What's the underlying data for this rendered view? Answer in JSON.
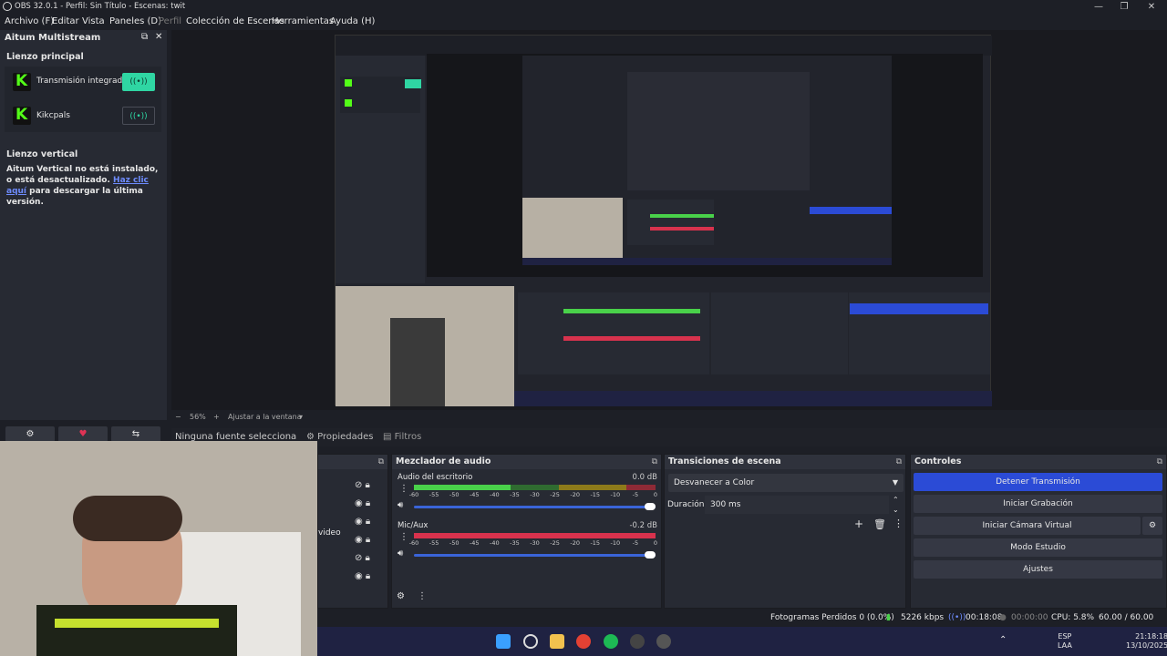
{
  "window": {
    "title": "OBS 32.0.1 - Perfil: Sin Título - Escenas: twit",
    "min": "—",
    "max": "❐",
    "close": "✕"
  },
  "menu": [
    "Archivo (F)",
    "Editar",
    "Vista",
    "Paneles (D)",
    "Perfil",
    "Colección de Escenas",
    "Herramientas",
    "Ayuda (H)"
  ],
  "aitum": {
    "title": "Aitum Multistream",
    "float_icon": "⧉",
    "close_icon": "✕",
    "main_canvas": "Lienzo principal",
    "outputs": [
      {
        "name": "Transmisión integrada",
        "status_icon": "((•))"
      },
      {
        "name": "Kikcpals",
        "status_icon": "((•))"
      }
    ],
    "vertical_canvas": "Lienzo vertical",
    "vertical_msg": "Aitum Vertical no está instalado, o está desactualizado.",
    "link": "Haz clic aquí",
    "link_rest": "para descargar la última versión."
  },
  "left_buttons": {
    "settings": "⚙",
    "heart": "♥",
    "share": "⇆"
  },
  "zoom": {
    "minus": "−",
    "value": "56%",
    "plus": "+",
    "fit": "Ajustar a la ventana",
    "arrow": "▾"
  },
  "sources_bar": {
    "none": "Ninguna fuente selecciona",
    "props": "Propiedades",
    "filters": "Filtros"
  },
  "sources_partial": {
    "video": "video"
  },
  "mixer": {
    "title": "Mezclador de audio",
    "icon": "⧉",
    "channels": [
      {
        "name": "Audio del escritorio",
        "db": "0.0 dB"
      },
      {
        "name": "Mic/Aux",
        "db": "-0.2 dB"
      }
    ],
    "ticks": [
      "-60",
      "-55",
      "-50",
      "-45",
      "-40",
      "-35",
      "-30",
      "-25",
      "-20",
      "-15",
      "-10",
      "-5",
      "0"
    ]
  },
  "transitions": {
    "title": "Transiciones de escena",
    "icon": "⧉",
    "selected": "Desvanecer a Color",
    "duration_label": "Duración",
    "duration": "300 ms"
  },
  "controls": {
    "title": "Controles",
    "icon": "⧉",
    "buttons": [
      "Detener Transmisión",
      "Iniciar Grabación",
      "Iniciar Cámara Virtual",
      "Modo Estudio",
      "Ajustes"
    ],
    "accent": "#2b4bd6"
  },
  "status": {
    "dropped": "Fotogramas Perdidos 0 (0.0%)",
    "kbps": "5226 kbps",
    "stream_time": "00:18:08",
    "rec_time": "00:00:00",
    "cpu": "CPU: 5.8%",
    "fps": "60.00 / 60.00 FPS"
  },
  "taskbar": {
    "lang1": "ESP",
    "lang2": "LAA",
    "time": "21:18:18",
    "date": "13/10/2025"
  },
  "colors": {
    "green": "#49d14a",
    "red": "#d8324d",
    "blue": "#3a64d8",
    "kick": "#53fc18"
  }
}
